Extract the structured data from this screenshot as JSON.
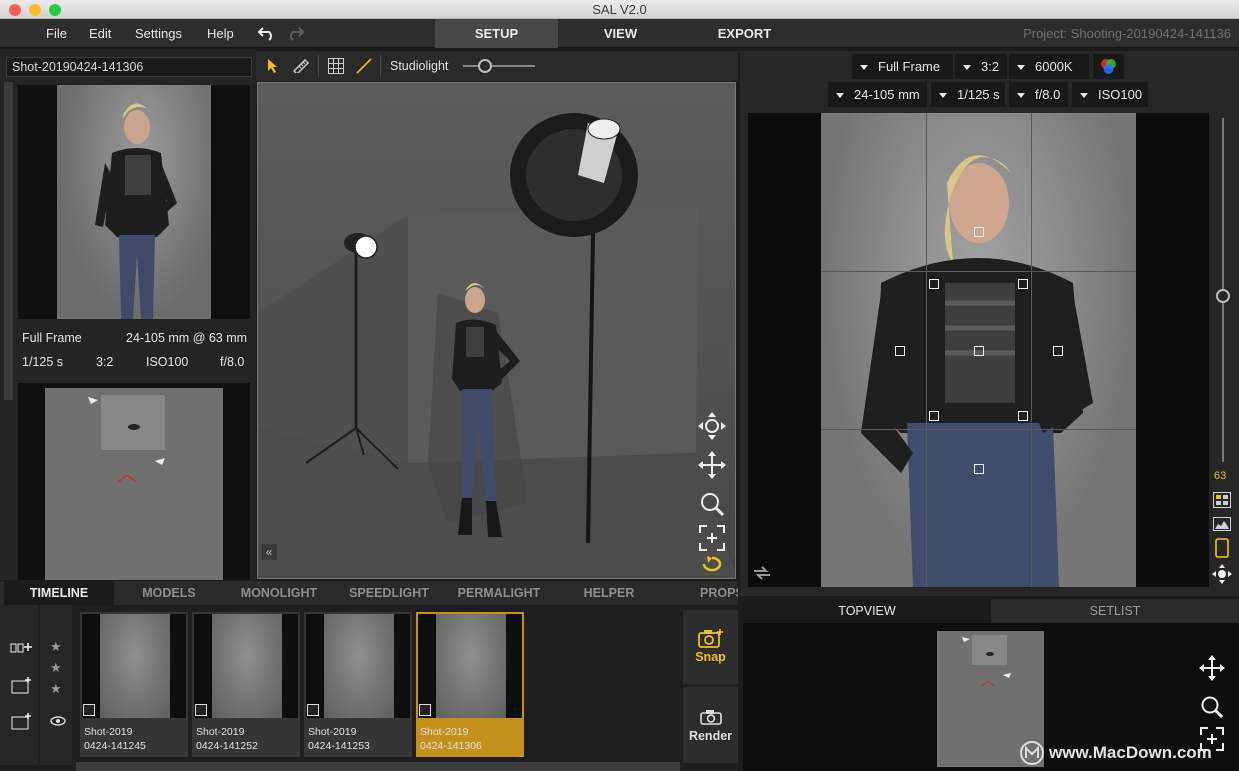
{
  "window": {
    "title": "SAL V2.0"
  },
  "menu": [
    "File",
    "Edit",
    "Settings",
    "Help"
  ],
  "modes": {
    "setup": "SETUP",
    "view": "VIEW",
    "export": "EXPORT"
  },
  "project": "Project: Shooting-20190424-141136",
  "shot_name": "Shot-20190424-141306",
  "toolbar": {
    "light_mode": "Studiolight",
    "slider_level": 0.3
  },
  "preview_info": {
    "sensor": "Full Frame",
    "lens": "24-105 mm @ 63 mm",
    "shutter": "1/125 s",
    "ratio": "3:2",
    "iso": "ISO100",
    "aperture": "f/8.0"
  },
  "camera_settings": {
    "sensor": "Full Frame",
    "ratio": "3:2",
    "white_balance": "6000K",
    "lens": "24-105 mm",
    "shutter": "1/125 s",
    "aperture": "f/8.0",
    "iso": "ISO100"
  },
  "focal_length_readout": "63",
  "bottom_tabs": [
    "TIMELINE",
    "MODELS",
    "MONOLIGHT",
    "SPEEDLIGHT",
    "PERMALIGHT",
    "HELPER",
    "PROPS"
  ],
  "shots": [
    {
      "line1": "Shot-2019",
      "line2": "0424-141245",
      "selected": false
    },
    {
      "line1": "Shot-2019",
      "line2": "0424-141252",
      "selected": false
    },
    {
      "line1": "Shot-2019",
      "line2": "0424-141253",
      "selected": false
    },
    {
      "line1": "Shot-2019",
      "line2": "0424-141306",
      "selected": true
    }
  ],
  "actions": {
    "snap": "Snap",
    "render": "Render"
  },
  "right_bottom_tabs": {
    "topview": "TOPVIEW",
    "setlist": "SETLIST"
  },
  "watermark": "www.MacDown.com",
  "colors": {
    "accent": "#f0c020",
    "selected_thumb": "#c4921a",
    "active_tab": "#474747"
  }
}
